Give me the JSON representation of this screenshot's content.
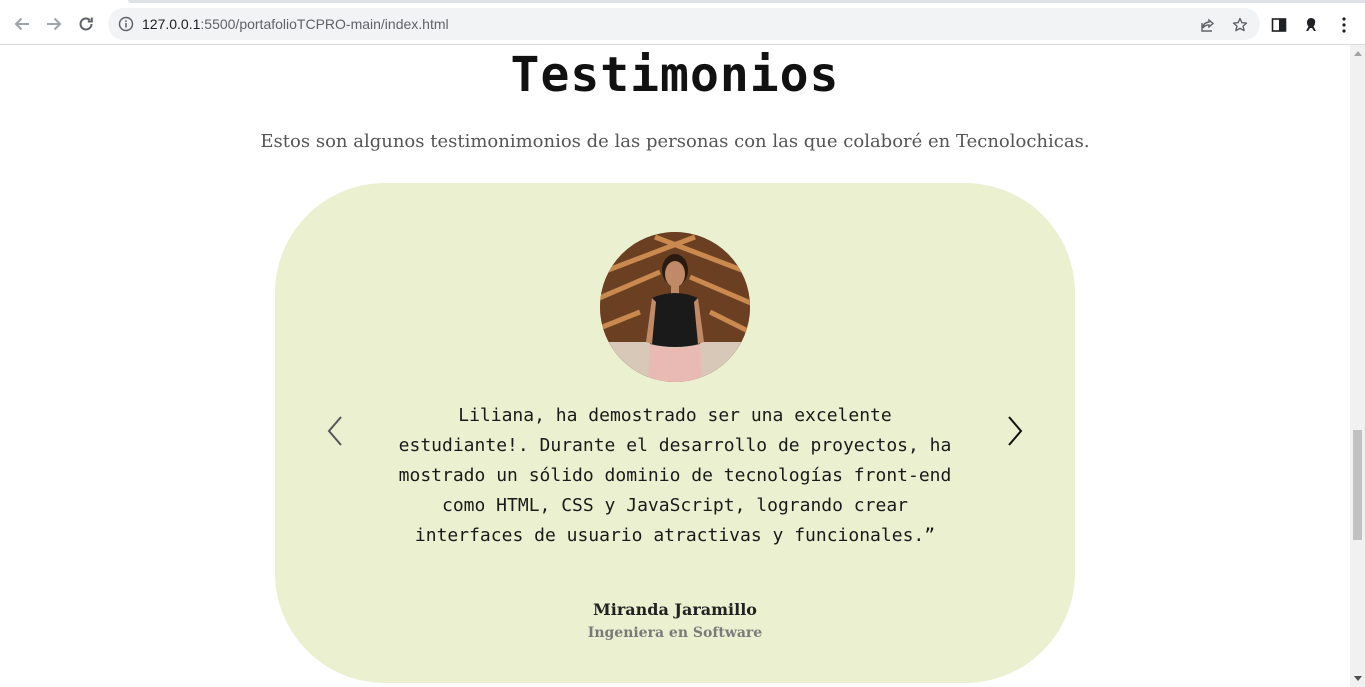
{
  "browser": {
    "url_host": "127.0.0.1",
    "url_rest": ":5500/portafolioTCPRO-main/index.html"
  },
  "page": {
    "title": "Testimonios",
    "subtitle": "Estos son algunos testimonimonios de las personas con las que colaboré en Tecnolochicas.",
    "testimonial": {
      "quote": "Liliana, ha demostrado ser una excelente estudiante!. Durante el desarrollo de proyectos, ha mostrado un sólido dominio de tecnologías front-end como HTML, CSS y JavaScript, logrando crear interfaces de usuario atractivas y funcionales.”",
      "name": "Miranda Jaramillo",
      "role": "Ingeniera en Software"
    }
  },
  "colors": {
    "card_bg": "#ebf0d0",
    "title": "#111111",
    "subtitle": "#555555"
  },
  "icons": [
    "back-icon",
    "forward-icon",
    "reload-icon",
    "info-icon",
    "share-icon",
    "star-icon",
    "side-panel-icon",
    "profile-icon",
    "menu-icon",
    "chevron-left-icon",
    "chevron-right-icon"
  ]
}
